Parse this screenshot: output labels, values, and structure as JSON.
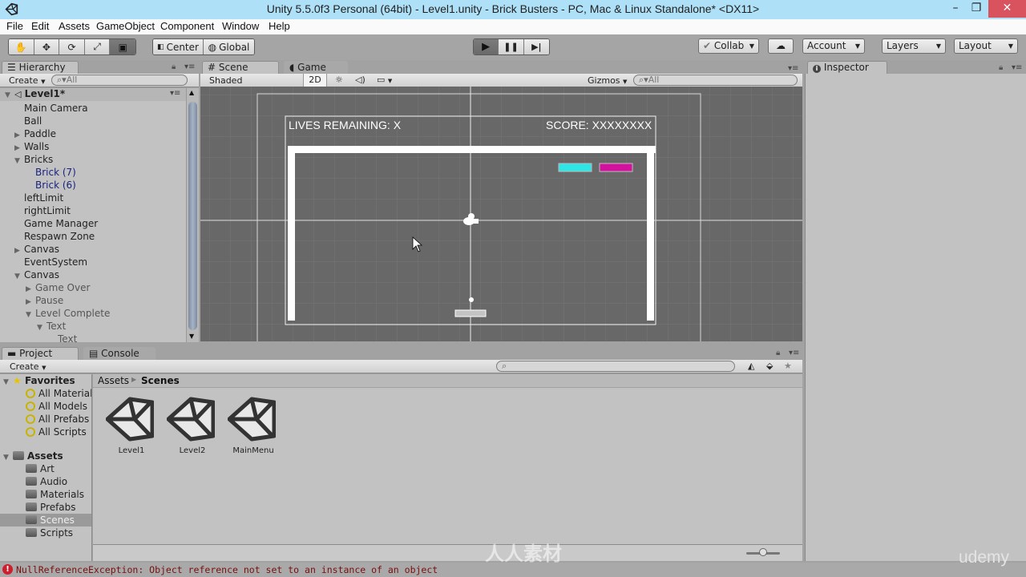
{
  "window": {
    "title": "Unity 5.5.0f3 Personal (64bit) - Level1.unity - Brick Busters - PC, Mac & Linux Standalone* <DX11>",
    "controls": {
      "minimize": "–",
      "restore": "❐",
      "close": "✕"
    }
  },
  "menu": [
    "File",
    "Edit",
    "Assets",
    "GameObject",
    "Component",
    "Window",
    "Help"
  ],
  "toolbar": {
    "tools": [
      {
        "name": "hand-tool",
        "glyph": "✋"
      },
      {
        "name": "move-tool",
        "glyph": "✥"
      },
      {
        "name": "rotate-tool",
        "glyph": "⟳"
      },
      {
        "name": "scale-tool",
        "glyph": "⤢"
      },
      {
        "name": "rect-tool",
        "glyph": "▣",
        "active": true
      }
    ],
    "pivot": "Center",
    "pivot_rotation": "Global",
    "play": {
      "play": "▶",
      "pause": "❚❚",
      "step": "▶|",
      "playing": true
    },
    "collab": "Collab",
    "account": "Account",
    "layers": "Layers",
    "layout": "Layout"
  },
  "hierarchy": {
    "tab": "Hierarchy",
    "create": "Create",
    "search_placeholder": "All",
    "scene": "Level1*",
    "items": [
      {
        "label": "Main Camera",
        "depth": 1,
        "arrow": ""
      },
      {
        "label": "Ball",
        "depth": 1,
        "arrow": ""
      },
      {
        "label": "Paddle",
        "depth": 1,
        "arrow": "▶"
      },
      {
        "label": "Walls",
        "depth": 1,
        "arrow": "▶"
      },
      {
        "label": "Bricks",
        "depth": 1,
        "arrow": "▼"
      },
      {
        "label": "Brick (7)",
        "depth": 2,
        "arrow": "",
        "style": "blue"
      },
      {
        "label": "Brick (6)",
        "depth": 2,
        "arrow": "",
        "style": "blue"
      },
      {
        "label": "leftLimit",
        "depth": 1,
        "arrow": ""
      },
      {
        "label": "rightLimit",
        "depth": 1,
        "arrow": ""
      },
      {
        "label": "Game Manager",
        "depth": 1,
        "arrow": ""
      },
      {
        "label": "Respawn Zone",
        "depth": 1,
        "arrow": ""
      },
      {
        "label": "Canvas",
        "depth": 1,
        "arrow": "▶"
      },
      {
        "label": "EventSystem",
        "depth": 1,
        "arrow": ""
      },
      {
        "label": "Canvas",
        "depth": 1,
        "arrow": "▼"
      },
      {
        "label": "Game Over",
        "depth": 2,
        "arrow": "▶",
        "style": "dim"
      },
      {
        "label": "Pause",
        "depth": 2,
        "arrow": "▶",
        "style": "dim"
      },
      {
        "label": "Level Complete",
        "depth": 2,
        "arrow": "▼",
        "style": "dim"
      },
      {
        "label": "Text",
        "depth": 3,
        "arrow": "▼",
        "style": "dim"
      },
      {
        "label": "Text",
        "depth": 4,
        "arrow": "",
        "style": "dim"
      }
    ]
  },
  "scene": {
    "tabs": [
      "Scene",
      "Game"
    ],
    "shading": "Shaded",
    "mode2d": "2D",
    "gizmos": "Gizmos",
    "search_placeholder": "All",
    "hud": {
      "lives": "LIVES REMAINING: X",
      "score": "SCORE: XXXXXXXX"
    },
    "brick_colors": [
      "#2ee6e6",
      "#d4119f"
    ]
  },
  "inspector": {
    "tab": "Inspector"
  },
  "project": {
    "tabs": [
      "Project",
      "Console"
    ],
    "create": "Create",
    "favorites": {
      "label": "Favorites",
      "items": [
        "All Materials",
        "All Models",
        "All Prefabs",
        "All Scripts"
      ]
    },
    "assets": {
      "label": "Assets",
      "folders": [
        "Art",
        "Audio",
        "Materials",
        "Prefabs",
        "Scenes",
        "Scripts"
      ],
      "selected": "Scenes"
    },
    "breadcrumb": [
      "Assets",
      "Scenes"
    ],
    "files": [
      "Level1",
      "Level2",
      "MainMenu"
    ],
    "zoom_slider": 0.5
  },
  "status": {
    "message": "NullReferenceException: Object reference not set to an instance of an object"
  },
  "watermark": {
    "udemy": "udemy",
    "site": "人人素材"
  }
}
